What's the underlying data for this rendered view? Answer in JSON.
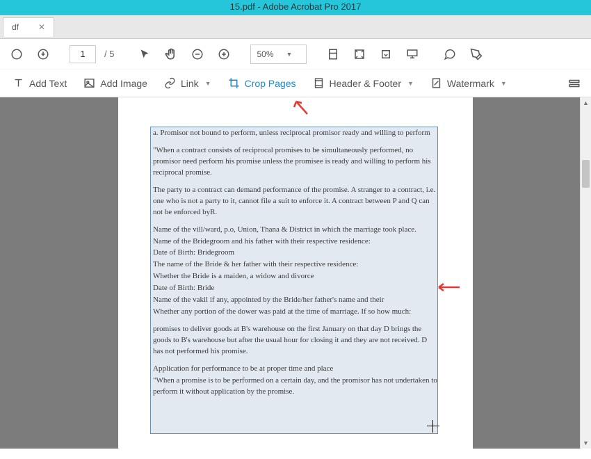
{
  "app": {
    "title": "15.pdf - Adobe Acrobat Pro 2017"
  },
  "tab": {
    "name": "df"
  },
  "toolbar": {
    "current_page": "1",
    "page_total": "/ 5",
    "zoom": "50%"
  },
  "edit": {
    "add_text": "Add Text",
    "add_image": "Add Image",
    "link": "Link",
    "crop_pages": "Crop Pages",
    "header_footer": "Header & Footer",
    "watermark": "Watermark"
  },
  "doc": {
    "p1": "a. Promisor not bound to perform, unless reciprocal promisor ready and willing to perform",
    "p2": "\"When a contract consists of reciprocal promises to be simultaneously performed, no promisor need perform his promise unless the promisee is ready and willing to perform his reciprocal promise.",
    "p3": "The party to a contract can demand performance of the promise. A stranger to a contract, i.e. one who is not a party to it, cannot file a suit to enforce it. A contract between P and Q can not be enforced byR.",
    "p4": "Name of the vill/ward, p.o, Union, Thana & District in which the marriage took place.",
    "p5": "Name of the Bridegroom and his father with their respective residence:",
    "p6": "Date of Birth: Bridegroom",
    "p7": "The name of the Bride & her father with their respective residence:",
    "p8": "Whether the Bride is a maiden, a widow and divorce",
    "p9": "Date of Birth: Bride",
    "p10": "Name of the vakil if any, appointed by the Bride/her father's name and their",
    "p11": "Whether any portion of the dower was paid at the time of marriage. If so how much:",
    "p12": "promises to deliver goods at B's warehouse on the first January on that day D brings the goods to B's warehouse but after the usual hour for closing it and they are not received. D has not performed his promise.",
    "p13": "Application for performance to be at proper time and place",
    "p14": "\"When a promise is to be performed on a certain day, and the promisor has not undertaken to perform it without application by the promise."
  }
}
